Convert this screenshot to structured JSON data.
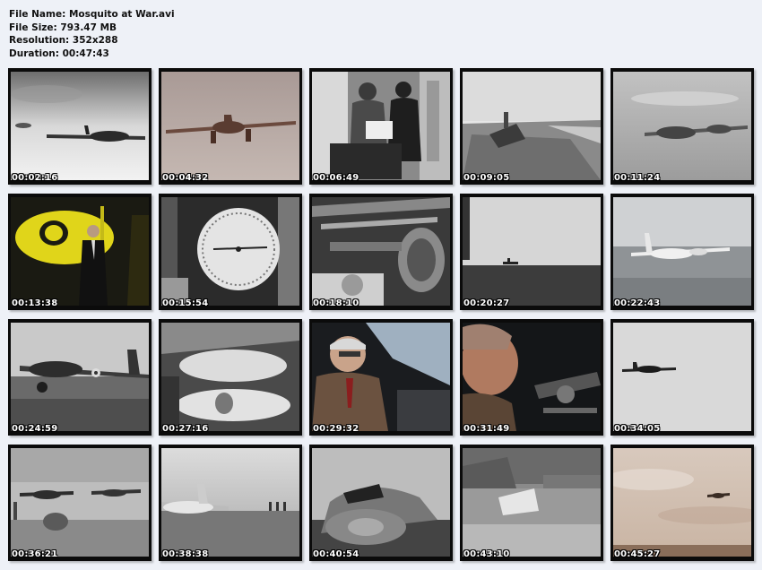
{
  "file_info": {
    "name_line": "File Name: Mosquito at War.avi",
    "size_line": "File Size: 793.47 MB",
    "resolution_line": "Resolution: 352x288",
    "duration_line": "Duration: 00:47:43"
  },
  "thumbnails": [
    {
      "timestamp": "00:02:16",
      "scene": "bw-sky-aircraft"
    },
    {
      "timestamp": "00:04:32",
      "scene": "sepia-aircraft-flight"
    },
    {
      "timestamp": "00:06:49",
      "scene": "men-in-office"
    },
    {
      "timestamp": "00:09:05",
      "scene": "field-wreckage"
    },
    {
      "timestamp": "00:11:24",
      "scene": "aircraft-in-clouds"
    },
    {
      "timestamp": "00:13:38",
      "scene": "yellow-aircraft-presenter"
    },
    {
      "timestamp": "00:15:54",
      "scene": "instrument-gauge"
    },
    {
      "timestamp": "00:18:10",
      "scene": "machinery-interior"
    },
    {
      "timestamp": "00:20:27",
      "scene": "aircraft-over-sea"
    },
    {
      "timestamp": "00:22:43",
      "scene": "aircraft-low-over-sea"
    },
    {
      "timestamp": "00:24:59",
      "scene": "aircraft-on-runway"
    },
    {
      "timestamp": "00:27:16",
      "scene": "factory-fuselages"
    },
    {
      "timestamp": "00:29:32",
      "scene": "color-interview-glasses"
    },
    {
      "timestamp": "00:31:49",
      "scene": "color-interview-cockpit"
    },
    {
      "timestamp": "00:34:05",
      "scene": "aircraft-distant-sky"
    },
    {
      "timestamp": "00:36:21",
      "scene": "airfield-aircraft"
    },
    {
      "timestamp": "00:38:38",
      "scene": "airfield-misty"
    },
    {
      "timestamp": "00:40:54",
      "scene": "cockpit-closeup"
    },
    {
      "timestamp": "00:43:10",
      "scene": "ship-at-sea"
    },
    {
      "timestamp": "00:45:27",
      "scene": "color-sky-aircraft"
    }
  ]
}
